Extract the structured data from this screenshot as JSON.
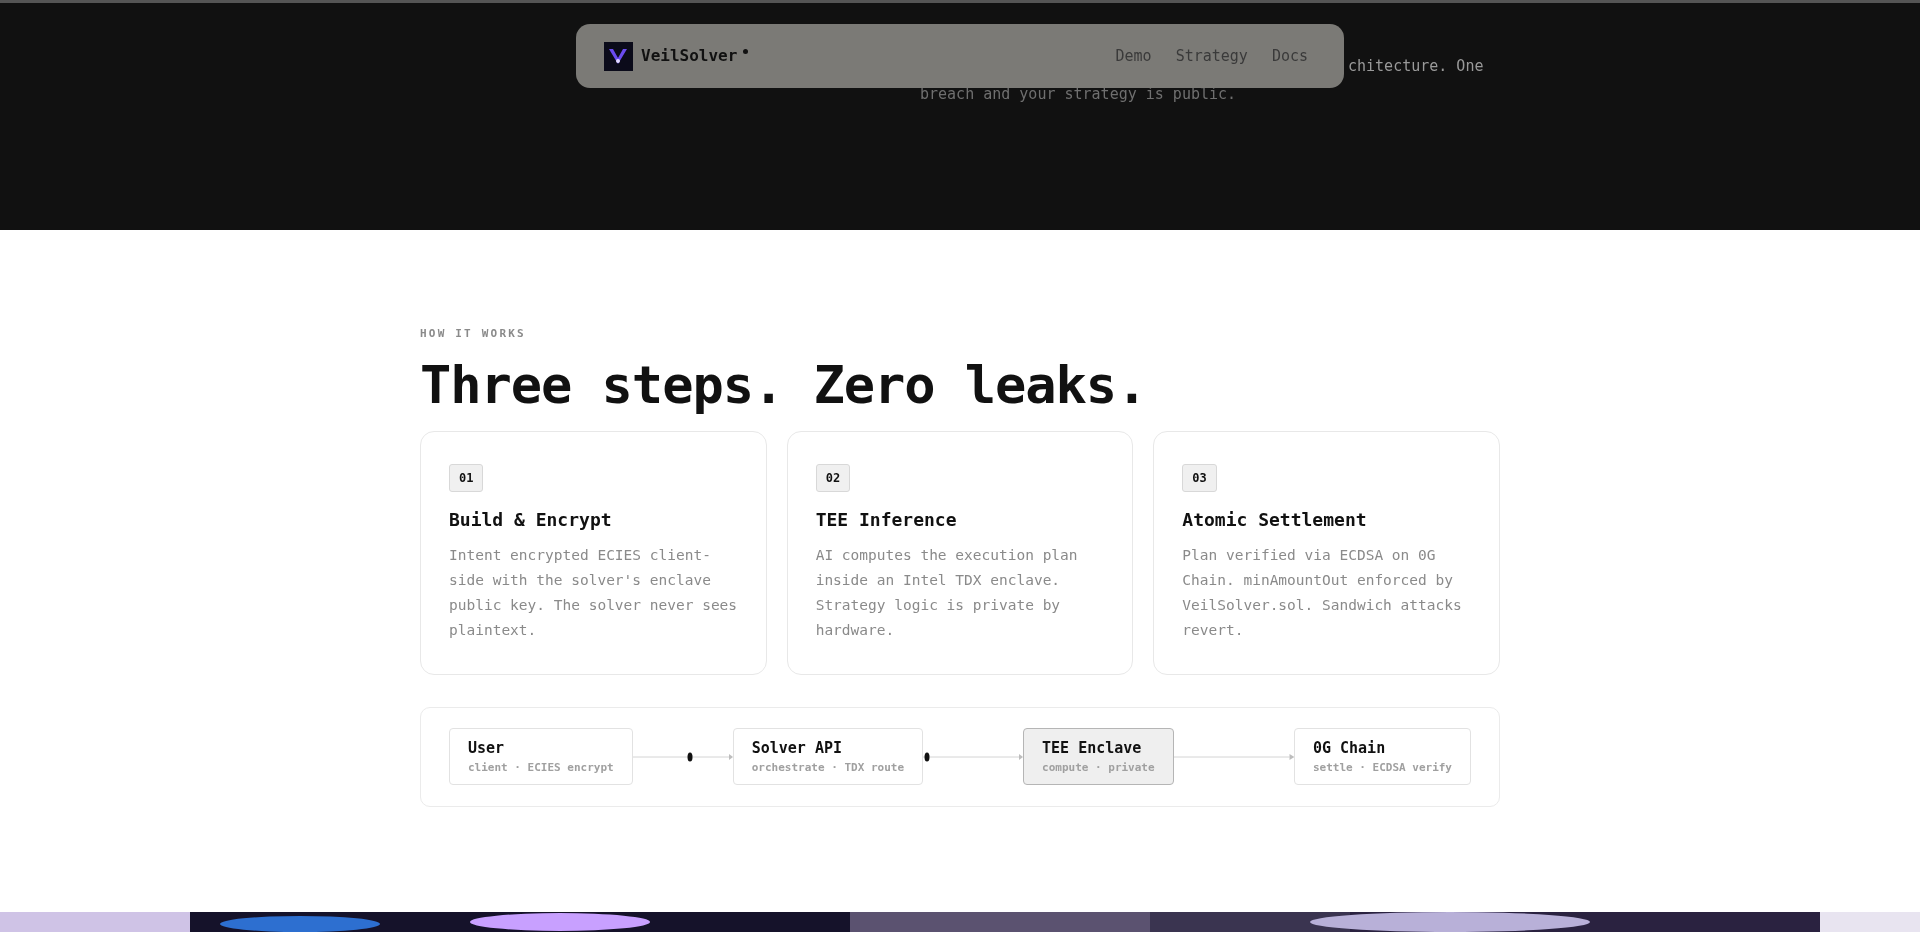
{
  "hero": {
    "text_right": "chitecture. One",
    "text_below": "breach and your strategy is public."
  },
  "nav": {
    "brand": "VeilSolver",
    "links": [
      {
        "label": "Demo"
      },
      {
        "label": "Strategy"
      },
      {
        "label": "Docs"
      }
    ]
  },
  "section": {
    "eyebrow": "HOW IT WORKS",
    "title": "Three steps. Zero leaks.",
    "steps": [
      {
        "number": "01",
        "title": "Build & Encrypt",
        "body": "Intent encrypted ECIES client-side with the solver's enclave public key. The solver never sees plaintext."
      },
      {
        "number": "02",
        "title": "TEE Inference",
        "body": "AI computes the execution plan inside an Intel TDX enclave. Strategy logic is private by hardware."
      },
      {
        "number": "03",
        "title": "Atomic Settlement",
        "body": "Plan verified via ECDSA on 0G Chain. minAmountOut enforced by VeilSolver.sol. Sandwich attacks revert."
      }
    ]
  },
  "flow": [
    {
      "title": "User",
      "subtitle": "client · ECIES encrypt",
      "selected": false
    },
    {
      "title": "Solver API",
      "subtitle": "orchestrate · TDX route",
      "selected": false
    },
    {
      "title": "TEE Enclave",
      "subtitle": "compute · private",
      "selected": true
    },
    {
      "title": "0G Chain",
      "subtitle": "settle · ECDSA verify",
      "selected": false
    }
  ]
}
